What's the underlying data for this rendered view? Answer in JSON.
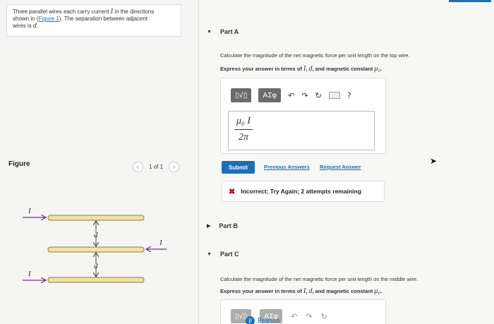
{
  "intro": {
    "line1_a": "Three parallel wires each carry current ",
    "line1_var": "I",
    "line1_b": " in the directions",
    "line2_a": "shown in (",
    "line2_link": "Figure 1",
    "line2_b": "). The separation between adjacent",
    "line3_a": "wires is ",
    "line3_var": "d",
    "line3_b": "."
  },
  "figure": {
    "label": "Figure",
    "pager_text": "1 of 1",
    "prev_glyph": "<",
    "next_glyph": ">",
    "wire_label": "I",
    "separation_label": "d"
  },
  "review_bar_color": "#1a6fb5",
  "partA": {
    "title": "Part A",
    "question": "Calculate the magnitude of the net magnetic force per unit length on the top wire.",
    "instruction_a": "Express your answer in terms of ",
    "var_I": "I",
    "sep1": ", ",
    "var_d": "d",
    "instruction_b": ", and magnetic constant ",
    "var_mu": "μ₀",
    "end": ".",
    "toolbar": {
      "templates_label": "▯√▯",
      "symbols_label": "ΑΣφ",
      "undo_icon": "↶",
      "redo_icon": "↷",
      "reset_icon": "↻",
      "help_label": "?"
    },
    "answer": {
      "numerator": "μ₀ I",
      "denominator": "2π"
    },
    "submit_label": "Submit",
    "previous_answers_label": "Previous Answers",
    "request_answer_label": "Request Answer",
    "feedback_icon": "✖",
    "feedback_text": "Incorrect; Try Again; 2 attempts remaining"
  },
  "partB": {
    "title": "Part B"
  },
  "partC": {
    "title": "Part C",
    "question": "Calculate the magnitude of the net magnetic force per unit length on the middle wire.",
    "instruction_a": "Express your answer in terms of ",
    "var_I": "I",
    "sep1": ", ",
    "var_d": "d",
    "instruction_b": ", and magnetic constant ",
    "var_mu": "μ₀",
    "end": "."
  },
  "brand": {
    "logo": "P",
    "name": "Pearson"
  },
  "colors": {
    "accent": "#1a6fb5",
    "error": "#d0021b",
    "wire_fill": "#f3e2a6",
    "arrow_purple": "#7a2d8c"
  }
}
